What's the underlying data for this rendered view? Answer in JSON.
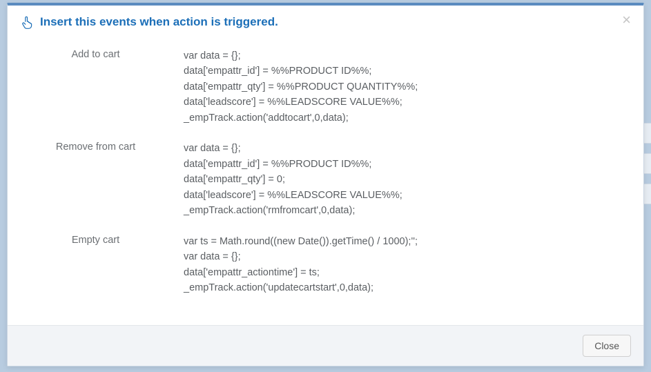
{
  "modal": {
    "title": "Insert this events when action is triggered.",
    "close_x": "×"
  },
  "events": [
    {
      "label": "Add to cart",
      "code": "var data = {};\ndata['empattr_id'] = %%PRODUCT ID%%;\ndata['empattr_qty'] = %%PRODUCT QUANTITY%%;\ndata['leadscore'] = %%LEADSCORE VALUE%%;\n_empTrack.action('addtocart',0,data);"
    },
    {
      "label": "Remove from cart",
      "code": "var data = {};\ndata['empattr_id'] = %%PRODUCT ID%%;\ndata['empattr_qty'] = 0;\ndata['leadscore'] = %%LEADSCORE VALUE%%;\n_empTrack.action('rmfromcart',0,data);"
    },
    {
      "label": "Empty cart",
      "code": "var ts = Math.round((new Date()).getTime() / 1000);'';\nvar data = {};\ndata['empattr_actiontime'] = ts;\n_empTrack.action('updatecartstart',0,data);"
    }
  ],
  "footer": {
    "close_label": "Close"
  }
}
